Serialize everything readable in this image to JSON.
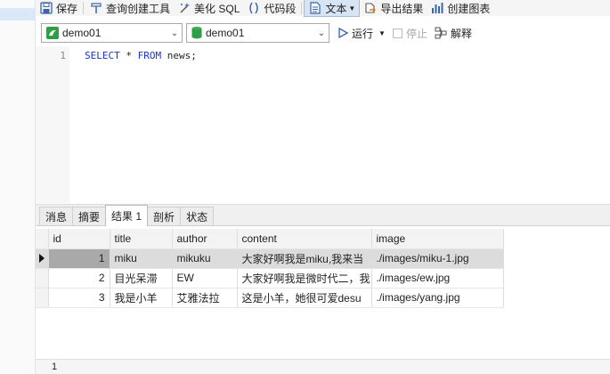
{
  "toolbar": {
    "save": "保存",
    "query_builder": "查询创建工具",
    "beautify_sql": "美化 SQL",
    "code_snippet": "代码段",
    "text": "文本",
    "export_result": "导出结果",
    "create_chart": "创建图表"
  },
  "connection": {
    "connection_value": "demo01",
    "database_value": "demo01",
    "run": "运行",
    "stop": "停止",
    "explain": "解释"
  },
  "editor": {
    "line_number": "1",
    "sql_keyword_select": "SELECT",
    "sql_star": " * ",
    "sql_keyword_from": "FROM",
    "sql_rest": " news;"
  },
  "result_tabs": [
    "消息",
    "摘要",
    "结果 1",
    "剖析",
    "状态"
  ],
  "grid": {
    "columns": [
      "id",
      "title",
      "author",
      "content",
      "image"
    ],
    "rows": [
      {
        "id": "1",
        "title": "miku",
        "author": "mikuku",
        "content": "大家好啊我是miku,我来当",
        "image": "./images/miku-1.jpg"
      },
      {
        "id": "2",
        "title": "目光呆滞",
        "author": "EW",
        "content": "大家好啊我是微时代二，我",
        "image": "./images/ew.jpg"
      },
      {
        "id": "3",
        "title": "我是小羊",
        "author": "艾雅法拉",
        "content": "这是小羊，她很可爱desu",
        "image": "./images/yang.jpg"
      }
    ]
  },
  "status": {
    "text": "1"
  },
  "colors": {
    "accent": "#d6e4f4",
    "keyword": "#1a35c9",
    "selected_row": "#dcdcdc"
  }
}
